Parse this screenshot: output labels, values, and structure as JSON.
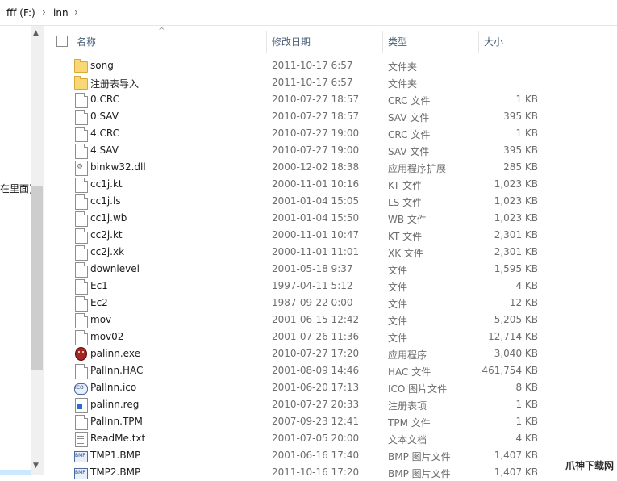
{
  "address_bar": {
    "segments": [
      "fff (F:)",
      "inn"
    ],
    "separator": "›"
  },
  "navigation_pane": {
    "partial_text": "在里面)"
  },
  "columns": {
    "name": "名称",
    "date": "修改日期",
    "type": "类型",
    "size": "大小"
  },
  "files": [
    {
      "name": "song",
      "date": "2011-10-17 6:57",
      "type": "文件夹",
      "size": "",
      "icon": "folder"
    },
    {
      "name": "注册表导入",
      "date": "2011-10-17 6:57",
      "type": "文件夹",
      "size": "",
      "icon": "folder"
    },
    {
      "name": "0.CRC",
      "date": "2010-07-27 18:57",
      "type": "CRC 文件",
      "size": "1 KB",
      "icon": "file"
    },
    {
      "name": "0.SAV",
      "date": "2010-07-27 18:57",
      "type": "SAV 文件",
      "size": "395 KB",
      "icon": "file"
    },
    {
      "name": "4.CRC",
      "date": "2010-07-27 19:00",
      "type": "CRC 文件",
      "size": "1 KB",
      "icon": "file"
    },
    {
      "name": "4.SAV",
      "date": "2010-07-27 19:00",
      "type": "SAV 文件",
      "size": "395 KB",
      "icon": "file"
    },
    {
      "name": "binkw32.dll",
      "date": "2000-12-02 18:38",
      "type": "应用程序扩展",
      "size": "285 KB",
      "icon": "dll"
    },
    {
      "name": "cc1j.kt",
      "date": "2000-11-01 10:16",
      "type": "KT 文件",
      "size": "1,023 KB",
      "icon": "file"
    },
    {
      "name": "cc1j.ls",
      "date": "2001-01-04 15:05",
      "type": "LS 文件",
      "size": "1,023 KB",
      "icon": "file"
    },
    {
      "name": "cc1j.wb",
      "date": "2001-01-04 15:50",
      "type": "WB 文件",
      "size": "1,023 KB",
      "icon": "file"
    },
    {
      "name": "cc2j.kt",
      "date": "2000-11-01 10:47",
      "type": "KT 文件",
      "size": "2,301 KB",
      "icon": "file"
    },
    {
      "name": "cc2j.xk",
      "date": "2000-11-01 11:01",
      "type": "XK 文件",
      "size": "2,301 KB",
      "icon": "file"
    },
    {
      "name": "downlevel",
      "date": "2001-05-18 9:37",
      "type": "文件",
      "size": "1,595 KB",
      "icon": "file"
    },
    {
      "name": "Ec1",
      "date": "1997-04-11 5:12",
      "type": "文件",
      "size": "4 KB",
      "icon": "file"
    },
    {
      "name": "Ec2",
      "date": "1987-09-22 0:00",
      "type": "文件",
      "size": "12 KB",
      "icon": "file"
    },
    {
      "name": "mov",
      "date": "2001-06-15 12:42",
      "type": "文件",
      "size": "5,205 KB",
      "icon": "file"
    },
    {
      "name": "mov02",
      "date": "2001-07-26 11:36",
      "type": "文件",
      "size": "12,714 KB",
      "icon": "file"
    },
    {
      "name": "palinn.exe",
      "date": "2010-07-27 17:20",
      "type": "应用程序",
      "size": "3,040 KB",
      "icon": "exe"
    },
    {
      "name": "PalInn.HAC",
      "date": "2001-08-09 14:46",
      "type": "HAC 文件",
      "size": "461,754 KB",
      "icon": "file"
    },
    {
      "name": "PalInn.ico",
      "date": "2001-06-20 17:13",
      "type": "ICO 图片文件",
      "size": "8 KB",
      "icon": "ico"
    },
    {
      "name": "palinn.reg",
      "date": "2010-07-27 20:33",
      "type": "注册表项",
      "size": "1 KB",
      "icon": "reg"
    },
    {
      "name": "PalInn.TPM",
      "date": "2007-09-23 12:41",
      "type": "TPM 文件",
      "size": "1 KB",
      "icon": "file"
    },
    {
      "name": "ReadMe.txt",
      "date": "2001-07-05 20:00",
      "type": "文本文档",
      "size": "4 KB",
      "icon": "txt"
    },
    {
      "name": "TMP1.BMP",
      "date": "2001-06-16 17:40",
      "type": "BMP 图片文件",
      "size": "1,407 KB",
      "icon": "bmp"
    },
    {
      "name": "TMP2.BMP",
      "date": "2011-10-16 17:20",
      "type": "BMP 图片文件",
      "size": "1,407 KB",
      "icon": "bmp"
    }
  ],
  "watermark": "爪神下载网"
}
